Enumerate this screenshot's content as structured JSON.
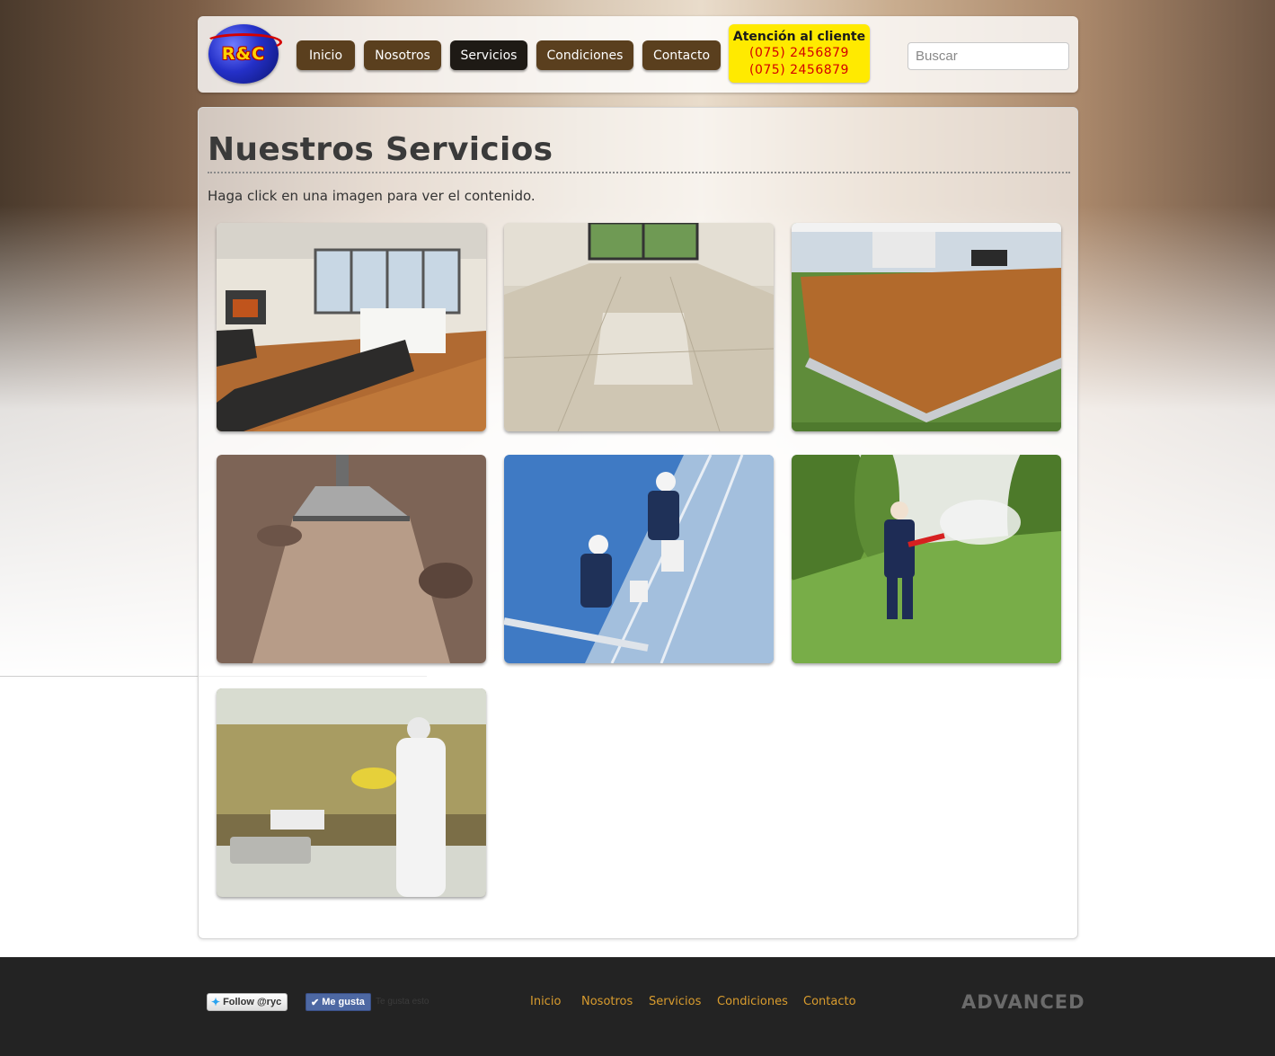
{
  "header": {
    "logo_text": "R&C",
    "nav": [
      {
        "label": "Inicio",
        "active": false
      },
      {
        "label": "Nosotros",
        "active": false
      },
      {
        "label": "Servicios",
        "active": true
      },
      {
        "label": "Condiciones",
        "active": false
      },
      {
        "label": "Contacto",
        "active": false
      }
    ],
    "phone": {
      "title": "Atención al cliente",
      "numbers": [
        "(075) 2456879",
        "(075) 2456879"
      ]
    },
    "search_placeholder": "Buscar"
  },
  "main": {
    "title": "Nuestros Servicios",
    "intro": "Haga click en una imagen para ver el contenido.",
    "images": [
      {
        "name": "hardwood-living-room"
      },
      {
        "name": "polished-marble-floor"
      },
      {
        "name": "wooden-dance-floor-on-grass"
      },
      {
        "name": "carpet-cleaning"
      },
      {
        "name": "window-cleaning-workers"
      },
      {
        "name": "orchard-fumigation"
      },
      {
        "name": "kitchen-fumigation"
      }
    ]
  },
  "footer": {
    "twitter_label": "Follow @ryc",
    "facebook_label": "Me gusta",
    "facebook_count": "Te gusta esto",
    "nav": [
      "Inicio",
      "Nosotros",
      "Servicios",
      "Condiciones",
      "Contacto"
    ],
    "brand": "ADVANCED"
  },
  "colors": {
    "nav_button": "#5a3f1e",
    "nav_active": "#1e1a15",
    "phone_bg": "#ffea00",
    "phone_number": "#d40000",
    "footer_bg": "#232323",
    "footer_link": "#d99c2e"
  }
}
